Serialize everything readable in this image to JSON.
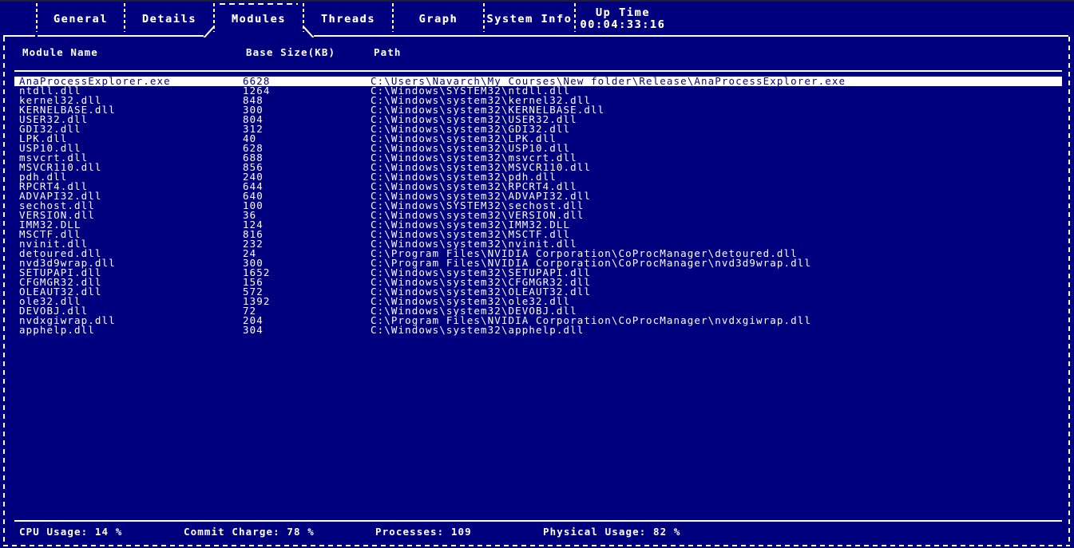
{
  "app": {
    "theme": {
      "background": "#00007f",
      "foreground": "#ffffff",
      "selection_bg": "#ffffff",
      "selection_fg": "#00007f"
    }
  },
  "tabs": [
    {
      "id": "general",
      "label": "General",
      "active": false
    },
    {
      "id": "details",
      "label": "Details",
      "active": false
    },
    {
      "id": "modules",
      "label": "Modules",
      "active": true
    },
    {
      "id": "threads",
      "label": "Threads",
      "active": false
    },
    {
      "id": "graph",
      "label": "Graph",
      "active": false
    },
    {
      "id": "system-info",
      "label": "System Info",
      "active": false
    },
    {
      "id": "up-time",
      "label": "Up Time",
      "sublabel": "00:04:33:16",
      "active": false
    }
  ],
  "table": {
    "columns": [
      {
        "key": "name",
        "label": "Module Name"
      },
      {
        "key": "size",
        "label": "Base Size(KB)"
      },
      {
        "key": "path",
        "label": "Path"
      }
    ],
    "rows": [
      {
        "name": "AnaProcessExplorer.exe",
        "size": "6628",
        "path": "C:\\Users\\Navarch\\My Courses\\New folder\\Release\\AnaProcessExplorer.exe",
        "selected": true
      },
      {
        "name": "ntdll.dll",
        "size": "1264",
        "path": "C:\\Windows\\SYSTEM32\\ntdll.dll",
        "selected": false
      },
      {
        "name": "kernel32.dll",
        "size": "848",
        "path": "C:\\Windows\\system32\\kernel32.dll",
        "selected": false
      },
      {
        "name": "KERNELBASE.dll",
        "size": "300",
        "path": "C:\\Windows\\system32\\KERNELBASE.dll",
        "selected": false
      },
      {
        "name": "USER32.dll",
        "size": "804",
        "path": "C:\\Windows\\system32\\USER32.dll",
        "selected": false
      },
      {
        "name": "GDI32.dll",
        "size": "312",
        "path": "C:\\Windows\\system32\\GDI32.dll",
        "selected": false
      },
      {
        "name": "LPK.dll",
        "size": "40",
        "path": "C:\\Windows\\system32\\LPK.dll",
        "selected": false
      },
      {
        "name": "USP10.dll",
        "size": "628",
        "path": "C:\\Windows\\system32\\USP10.dll",
        "selected": false
      },
      {
        "name": "msvcrt.dll",
        "size": "688",
        "path": "C:\\Windows\\system32\\msvcrt.dll",
        "selected": false
      },
      {
        "name": "MSVCR110.dll",
        "size": "856",
        "path": "C:\\Windows\\system32\\MSVCR110.dll",
        "selected": false
      },
      {
        "name": "pdh.dll",
        "size": "240",
        "path": "C:\\Windows\\system32\\pdh.dll",
        "selected": false
      },
      {
        "name": "RPCRT4.dll",
        "size": "644",
        "path": "C:\\Windows\\system32\\RPCRT4.dll",
        "selected": false
      },
      {
        "name": "ADVAPI32.dll",
        "size": "640",
        "path": "C:\\Windows\\system32\\ADVAPI32.dll",
        "selected": false
      },
      {
        "name": "sechost.dll",
        "size": "100",
        "path": "C:\\Windows\\SYSTEM32\\sechost.dll",
        "selected": false
      },
      {
        "name": "VERSION.dll",
        "size": "36",
        "path": "C:\\Windows\\system32\\VERSION.dll",
        "selected": false
      },
      {
        "name": "IMM32.DLL",
        "size": "124",
        "path": "C:\\Windows\\system32\\IMM32.DLL",
        "selected": false
      },
      {
        "name": "MSCTF.dll",
        "size": "816",
        "path": "C:\\Windows\\system32\\MSCTF.dll",
        "selected": false
      },
      {
        "name": "nvinit.dll",
        "size": "232",
        "path": "C:\\Windows\\system32\\nvinit.dll",
        "selected": false
      },
      {
        "name": "detoured.dll",
        "size": "24",
        "path": "C:\\Program Files\\NVIDIA Corporation\\CoProcManager\\detoured.dll",
        "selected": false
      },
      {
        "name": "nvd3d9wrap.dll",
        "size": "300",
        "path": "C:\\Program Files\\NVIDIA Corporation\\CoProcManager\\nvd3d9wrap.dll",
        "selected": false
      },
      {
        "name": "SETUPAPI.dll",
        "size": "1652",
        "path": "C:\\Windows\\system32\\SETUPAPI.dll",
        "selected": false
      },
      {
        "name": "CFGMGR32.dll",
        "size": "156",
        "path": "C:\\Windows\\system32\\CFGMGR32.dll",
        "selected": false
      },
      {
        "name": "OLEAUT32.dll",
        "size": "572",
        "path": "C:\\Windows\\system32\\OLEAUT32.dll",
        "selected": false
      },
      {
        "name": "ole32.dll",
        "size": "1392",
        "path": "C:\\Windows\\system32\\ole32.dll",
        "selected": false
      },
      {
        "name": "DEVOBJ.dll",
        "size": "72",
        "path": "C:\\Windows\\system32\\DEVOBJ.dll",
        "selected": false
      },
      {
        "name": "nvdxgiwrap.dll",
        "size": "204",
        "path": "C:\\Program Files\\NVIDIA Corporation\\CoProcManager\\nvdxgiwrap.dll",
        "selected": false
      },
      {
        "name": "apphelp.dll",
        "size": "304",
        "path": "C:\\Windows\\system32\\apphelp.dll",
        "selected": false
      }
    ]
  },
  "statusbar": [
    {
      "id": "cpu-usage",
      "label": "CPU Usage: 14 %"
    },
    {
      "id": "commit-charge",
      "label": "Commit Charge: 78 %"
    },
    {
      "id": "processes",
      "label": "Processes: 109"
    },
    {
      "id": "physical-usage",
      "label": "Physical Usage: 82 %"
    }
  ]
}
